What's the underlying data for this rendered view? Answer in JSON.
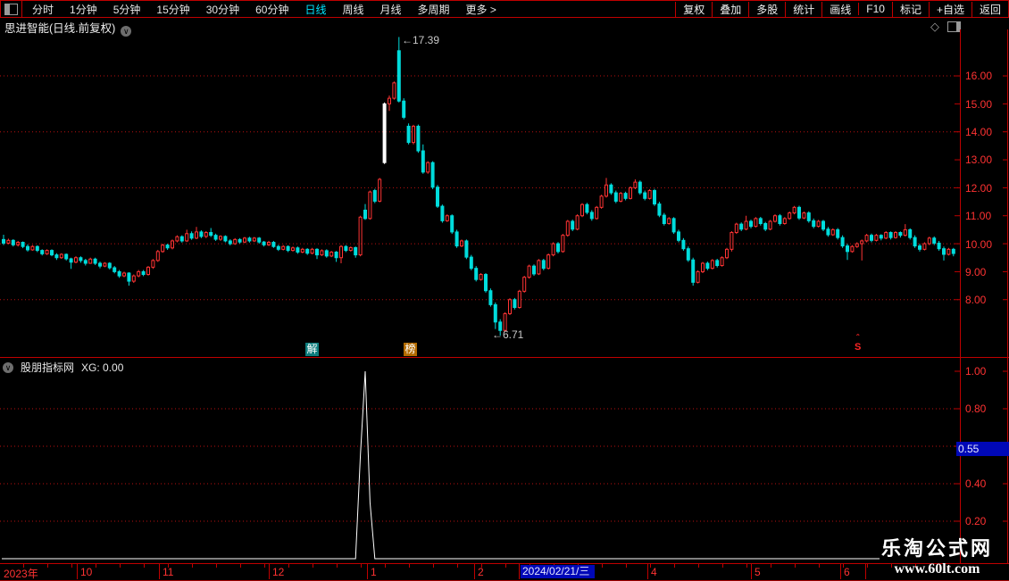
{
  "toolbar": {
    "left": [
      "分时",
      "1分钟",
      "5分钟",
      "15分钟",
      "30分钟",
      "60分钟",
      "日线",
      "周线",
      "月线",
      "多周期",
      "更多 >"
    ],
    "active_item": "日线",
    "right": [
      "复权",
      "叠加",
      "多股",
      "统计",
      "画线",
      "F10",
      "标记",
      "+自选",
      "返回"
    ]
  },
  "icons": {
    "diamond": "◇",
    "dropdown": "∨"
  },
  "price_panel": {
    "title": "思进智能(日线.前复权)",
    "y_axis": [
      "16.00",
      "15.00",
      "14.00",
      "13.00",
      "12.00",
      "11.00",
      "10.00",
      "9.00",
      "8.00"
    ],
    "high_label": "←17.39",
    "low_label": "←6.71",
    "event_badges": [
      {
        "label": "解"
      },
      {
        "label": "榜"
      }
    ],
    "s_marker": "S"
  },
  "indicator_panel": {
    "name": "股朋指标网",
    "readout": "XG: 0.00",
    "y_axis": [
      "1.00",
      "0.80",
      "0.40",
      "0.20"
    ],
    "value_badge": "0.55"
  },
  "time_axis": {
    "labels": [
      "2023年",
      "10",
      "11",
      "12",
      "1",
      "2",
      "4",
      "5",
      "6"
    ],
    "date_badge": "2024/02/21/三"
  },
  "watermark": {
    "line1": "乐淘公式网",
    "line2": "www.60lt.com"
  },
  "chart_data": [
    {
      "type": "candlestick",
      "title": "思进智能 日线 前复权",
      "ylim": [
        5.95,
        17.66
      ],
      "y_ticks": [
        8,
        9,
        10,
        11,
        12,
        13,
        14,
        15,
        16
      ],
      "grid_ticks": [
        8,
        10,
        12,
        14,
        16
      ],
      "x_months": [
        "2023-10",
        "2023-11",
        "2023-12",
        "2024-01",
        "2024-02",
        "2024-03",
        "2024-04",
        "2024-05",
        "2024-06"
      ],
      "high_annotation": 17.39,
      "low_annotation": 6.71,
      "white_candle_indices": [
        79
      ],
      "up_color": "#ff3434",
      "down_color": "#00dcdc",
      "white_color": "#ffffff",
      "candles": [
        [
          10.15,
          10.32,
          9.95,
          10.02
        ],
        [
          10.02,
          10.18,
          9.98,
          10.12
        ],
        [
          10.12,
          10.16,
          9.9,
          9.96
        ],
        [
          9.96,
          10.1,
          9.9,
          10.05
        ],
        [
          10.05,
          10.08,
          9.84,
          9.9
        ],
        [
          9.9,
          9.98,
          9.72,
          9.78
        ],
        [
          9.78,
          9.95,
          9.75,
          9.9
        ],
        [
          9.9,
          9.94,
          9.7,
          9.76
        ],
        [
          9.76,
          9.8,
          9.58,
          9.64
        ],
        [
          9.64,
          9.8,
          9.6,
          9.76
        ],
        [
          9.76,
          9.8,
          9.55,
          9.6
        ],
        [
          9.6,
          9.66,
          9.42,
          9.5
        ],
        [
          9.5,
          9.66,
          9.46,
          9.62
        ],
        [
          9.62,
          9.65,
          9.4,
          9.46
        ],
        [
          9.46,
          9.5,
          9.1,
          9.34
        ],
        [
          9.34,
          9.55,
          9.3,
          9.5
        ],
        [
          9.5,
          9.55,
          9.32,
          9.4
        ],
        [
          9.4,
          9.46,
          9.22,
          9.3
        ],
        [
          9.3,
          9.5,
          9.28,
          9.45
        ],
        [
          9.45,
          9.5,
          9.24,
          9.3
        ],
        [
          9.3,
          9.36,
          9.12,
          9.2
        ],
        [
          9.2,
          9.34,
          9.16,
          9.3
        ],
        [
          9.3,
          9.34,
          9.08,
          9.14
        ],
        [
          9.14,
          9.2,
          8.94,
          9.0
        ],
        [
          9.0,
          9.06,
          8.78,
          8.85
        ],
        [
          8.85,
          9.0,
          8.8,
          8.95
        ],
        [
          8.95,
          8.98,
          8.5,
          8.66
        ],
        [
          8.66,
          8.9,
          8.6,
          8.85
        ],
        [
          8.85,
          9.06,
          8.8,
          9.0
        ],
        [
          9.0,
          9.06,
          8.84,
          8.9
        ],
        [
          8.9,
          9.2,
          8.86,
          9.16
        ],
        [
          9.16,
          9.45,
          9.1,
          9.4
        ],
        [
          9.4,
          9.78,
          9.35,
          9.72
        ],
        [
          9.72,
          10.0,
          9.68,
          9.95
        ],
        [
          9.95,
          10.0,
          9.78,
          9.85
        ],
        [
          9.85,
          10.15,
          9.8,
          10.1
        ],
        [
          10.1,
          10.3,
          10.05,
          10.25
        ],
        [
          10.25,
          10.3,
          10.04,
          10.1
        ],
        [
          10.1,
          10.5,
          10.06,
          10.36
        ],
        [
          10.36,
          10.44,
          10.14,
          10.2
        ],
        [
          10.2,
          10.6,
          10.16,
          10.42
        ],
        [
          10.42,
          10.48,
          10.2,
          10.26
        ],
        [
          10.26,
          10.45,
          10.2,
          10.4
        ],
        [
          10.4,
          10.56,
          10.24,
          10.3
        ],
        [
          10.3,
          10.36,
          10.1,
          10.16
        ],
        [
          10.16,
          10.3,
          10.1,
          10.26
        ],
        [
          10.26,
          10.3,
          10.05,
          10.1
        ],
        [
          10.1,
          10.16,
          9.94,
          10.0
        ],
        [
          10.0,
          10.2,
          9.96,
          10.15
        ],
        [
          10.15,
          10.2,
          10.0,
          10.06
        ],
        [
          10.06,
          10.24,
          10.02,
          10.2
        ],
        [
          10.2,
          10.25,
          10.04,
          10.1
        ],
        [
          10.1,
          10.24,
          10.06,
          10.2
        ],
        [
          10.2,
          10.24,
          10.0,
          10.06
        ],
        [
          10.06,
          10.1,
          9.9,
          9.96
        ],
        [
          9.96,
          10.1,
          9.92,
          10.05
        ],
        [
          10.05,
          10.1,
          9.85,
          9.9
        ],
        [
          9.9,
          9.96,
          9.74,
          9.8
        ],
        [
          9.8,
          9.95,
          9.76,
          9.9
        ],
        [
          9.9,
          9.94,
          9.7,
          9.76
        ],
        [
          9.76,
          9.9,
          9.72,
          9.85
        ],
        [
          9.85,
          9.9,
          9.64,
          9.7
        ],
        [
          9.7,
          9.85,
          9.66,
          9.8
        ],
        [
          9.8,
          9.84,
          9.6,
          9.66
        ],
        [
          9.66,
          9.85,
          9.62,
          9.8
        ],
        [
          9.8,
          9.84,
          9.45,
          9.6
        ],
        [
          9.6,
          9.8,
          9.56,
          9.75
        ],
        [
          9.75,
          9.8,
          9.5,
          9.56
        ],
        [
          9.56,
          9.74,
          9.52,
          9.7
        ],
        [
          9.7,
          9.74,
          9.35,
          9.5
        ],
        [
          9.5,
          9.95,
          9.3,
          9.9
        ],
        [
          9.9,
          9.95,
          9.7,
          9.76
        ],
        [
          9.76,
          9.9,
          9.72,
          9.86
        ],
        [
          9.86,
          9.9,
          9.5,
          9.6
        ],
        [
          9.6,
          11.0,
          9.55,
          10.95
        ],
        [
          11.2,
          11.42,
          10.85,
          10.9
        ],
        [
          10.9,
          11.9,
          10.86,
          11.85
        ],
        [
          11.9,
          11.96,
          11.45,
          11.52
        ],
        [
          11.52,
          12.35,
          11.48,
          12.3
        ],
        [
          12.9,
          15.05,
          12.85,
          15.0
        ],
        [
          15.0,
          15.3,
          14.75,
          15.2
        ],
        [
          15.2,
          15.8,
          15.15,
          15.75
        ],
        [
          16.9,
          17.39,
          15.05,
          15.1
        ],
        [
          15.1,
          15.2,
          14.45,
          14.52
        ],
        [
          14.2,
          14.3,
          13.55,
          13.62
        ],
        [
          13.62,
          14.25,
          13.55,
          14.2
        ],
        [
          14.2,
          14.26,
          13.25,
          13.32
        ],
        [
          13.32,
          13.55,
          12.5,
          12.56
        ],
        [
          12.56,
          12.95,
          12.5,
          12.9
        ],
        [
          12.9,
          12.95,
          11.95,
          12.02
        ],
        [
          12.02,
          12.1,
          11.28,
          11.34
        ],
        [
          11.34,
          11.4,
          10.75,
          10.82
        ],
        [
          10.82,
          11.05,
          10.78,
          11.0
        ],
        [
          11.0,
          11.05,
          10.35,
          10.42
        ],
        [
          10.42,
          10.5,
          9.85,
          9.92
        ],
        [
          9.92,
          10.15,
          9.88,
          10.1
        ],
        [
          10.1,
          10.15,
          9.45,
          9.52
        ],
        [
          9.52,
          9.6,
          9.05,
          9.12
        ],
        [
          9.12,
          9.2,
          8.65,
          8.72
        ],
        [
          8.72,
          8.95,
          8.68,
          8.9
        ],
        [
          8.9,
          8.95,
          8.25,
          8.32
        ],
        [
          8.32,
          8.4,
          7.75,
          7.82
        ],
        [
          7.82,
          7.9,
          6.95,
          7.2
        ],
        [
          7.2,
          7.3,
          6.71,
          6.9
        ],
        [
          6.9,
          7.55,
          6.85,
          7.5
        ],
        [
          7.5,
          8.05,
          7.45,
          8.0
        ],
        [
          8.0,
          8.06,
          7.65,
          7.72
        ],
        [
          7.72,
          8.35,
          7.68,
          8.3
        ],
        [
          8.3,
          8.85,
          8.25,
          8.8
        ],
        [
          8.8,
          9.25,
          8.75,
          9.2
        ],
        [
          9.2,
          9.26,
          8.85,
          8.92
        ],
        [
          8.92,
          9.45,
          8.88,
          9.4
        ],
        [
          9.4,
          9.46,
          9.05,
          9.12
        ],
        [
          9.12,
          9.65,
          9.08,
          9.6
        ],
        [
          9.6,
          10.05,
          9.55,
          10.0
        ],
        [
          10.0,
          10.06,
          9.65,
          9.72
        ],
        [
          9.72,
          10.35,
          9.68,
          10.3
        ],
        [
          10.3,
          10.85,
          10.25,
          10.8
        ],
        [
          10.8,
          10.86,
          10.45,
          10.52
        ],
        [
          10.52,
          11.05,
          10.48,
          11.0
        ],
        [
          11.0,
          11.45,
          10.95,
          11.4
        ],
        [
          11.4,
          11.46,
          11.05,
          11.12
        ],
        [
          11.12,
          11.2,
          10.82,
          10.9
        ],
        [
          10.9,
          11.35,
          10.86,
          11.3
        ],
        [
          11.3,
          11.75,
          11.25,
          11.7
        ],
        [
          11.7,
          12.35,
          11.65,
          12.1
        ],
        [
          12.1,
          12.16,
          11.75,
          11.82
        ],
        [
          11.82,
          11.9,
          11.45,
          11.52
        ],
        [
          11.52,
          11.85,
          11.48,
          11.8
        ],
        [
          11.8,
          11.86,
          11.55,
          11.62
        ],
        [
          11.62,
          12.05,
          11.58,
          12.0
        ],
        [
          12.0,
          12.3,
          11.95,
          12.2
        ],
        [
          12.2,
          12.26,
          11.75,
          11.82
        ],
        [
          11.82,
          11.9,
          11.55,
          11.62
        ],
        [
          11.62,
          11.95,
          11.58,
          11.9
        ],
        [
          11.9,
          11.96,
          11.35,
          11.42
        ],
        [
          11.42,
          11.5,
          10.95,
          11.02
        ],
        [
          11.02,
          11.1,
          10.65,
          10.72
        ],
        [
          10.72,
          10.95,
          10.68,
          10.9
        ],
        [
          10.9,
          10.95,
          10.35,
          10.42
        ],
        [
          10.42,
          10.5,
          10.05,
          10.12
        ],
        [
          10.12,
          10.2,
          9.75,
          9.82
        ],
        [
          9.82,
          9.9,
          9.35,
          9.42
        ],
        [
          9.42,
          9.5,
          8.5,
          8.62
        ],
        [
          8.62,
          9.05,
          8.58,
          9.0
        ],
        [
          9.0,
          9.35,
          8.95,
          9.3
        ],
        [
          9.3,
          9.36,
          9.05,
          9.12
        ],
        [
          9.12,
          9.45,
          9.08,
          9.4
        ],
        [
          9.4,
          9.46,
          9.15,
          9.22
        ],
        [
          9.22,
          9.55,
          9.18,
          9.5
        ],
        [
          9.5,
          9.85,
          9.45,
          9.8
        ],
        [
          9.8,
          10.45,
          9.72,
          10.4
        ],
        [
          10.4,
          10.75,
          10.35,
          10.7
        ],
        [
          10.7,
          10.76,
          10.45,
          10.52
        ],
        [
          10.52,
          11.0,
          10.48,
          10.8
        ],
        [
          10.8,
          10.86,
          10.55,
          10.62
        ],
        [
          10.62,
          10.95,
          10.58,
          10.9
        ],
        [
          10.9,
          10.96,
          10.65,
          10.72
        ],
        [
          10.72,
          10.78,
          10.45,
          10.52
        ],
        [
          10.52,
          10.85,
          10.48,
          10.8
        ],
        [
          10.8,
          11.05,
          10.76,
          11.0
        ],
        [
          11.0,
          11.06,
          10.65,
          10.72
        ],
        [
          10.72,
          10.95,
          10.68,
          10.9
        ],
        [
          10.9,
          11.15,
          10.86,
          11.1
        ],
        [
          11.1,
          11.35,
          11.05,
          11.3
        ],
        [
          11.3,
          11.36,
          10.85,
          10.92
        ],
        [
          10.92,
          11.15,
          10.88,
          11.1
        ],
        [
          11.1,
          11.16,
          10.75,
          10.82
        ],
        [
          10.82,
          10.9,
          10.55,
          10.62
        ],
        [
          10.62,
          10.85,
          10.58,
          10.8
        ],
        [
          10.8,
          10.85,
          10.45,
          10.52
        ],
        [
          10.52,
          10.6,
          10.25,
          10.32
        ],
        [
          10.32,
          10.55,
          10.28,
          10.5
        ],
        [
          10.5,
          10.56,
          10.15,
          10.22
        ],
        [
          10.22,
          10.3,
          9.85,
          9.92
        ],
        [
          9.92,
          10.0,
          9.42,
          9.72
        ],
        [
          9.72,
          9.95,
          9.68,
          9.9
        ],
        [
          9.9,
          10.05,
          9.85,
          10.0
        ],
        [
          10.0,
          10.15,
          9.4,
          10.1
        ],
        [
          10.1,
          10.35,
          10.05,
          10.3
        ],
        [
          10.3,
          10.36,
          10.05,
          10.12
        ],
        [
          10.12,
          10.35,
          10.08,
          10.3
        ],
        [
          10.3,
          10.34,
          10.12,
          10.2
        ],
        [
          10.2,
          10.45,
          10.16,
          10.4
        ],
        [
          10.4,
          10.44,
          10.15,
          10.22
        ],
        [
          10.22,
          10.45,
          10.18,
          10.4
        ],
        [
          10.4,
          10.44,
          10.22,
          10.3
        ],
        [
          10.3,
          10.7,
          10.26,
          10.5
        ],
        [
          10.5,
          10.55,
          10.15,
          10.22
        ],
        [
          10.22,
          10.3,
          9.85,
          9.92
        ],
        [
          9.92,
          10.0,
          9.72,
          9.8
        ],
        [
          9.8,
          10.05,
          9.76,
          10.0
        ],
        [
          10.0,
          10.25,
          9.95,
          10.2
        ],
        [
          10.2,
          10.26,
          9.95,
          10.02
        ],
        [
          10.02,
          10.1,
          9.75,
          9.82
        ],
        [
          9.82,
          9.9,
          9.4,
          9.62
        ],
        [
          9.62,
          9.85,
          9.58,
          9.8
        ],
        [
          9.8,
          9.85,
          9.55,
          9.65
        ]
      ]
    },
    {
      "type": "line",
      "name": "XG",
      "current_value": 0.0,
      "ylim": [
        -0.02,
        1.07
      ],
      "y_ticks": [
        0.2,
        0.4,
        0.6,
        0.8,
        1.0
      ],
      "grid_ticks": [
        0.2,
        0.4,
        0.6,
        0.8
      ],
      "baseline": 0,
      "line_color": "#ffffff",
      "spike_points": [
        [
          73,
          0
        ],
        [
          74,
          0.55
        ],
        [
          75,
          1.0
        ],
        [
          76,
          0.3
        ],
        [
          77,
          0
        ]
      ]
    }
  ]
}
